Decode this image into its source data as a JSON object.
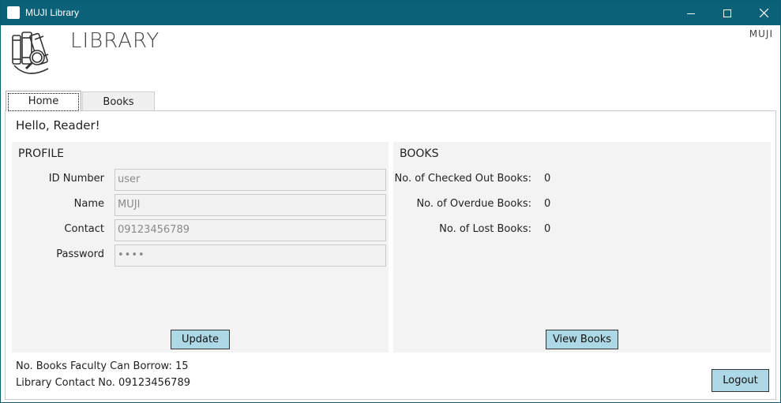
{
  "window": {
    "title": "MUJI Library",
    "controls": {
      "minimize": "minimize-icon",
      "maximize": "maximize-icon",
      "close": "close-icon"
    }
  },
  "header": {
    "brand": "LIBRARY",
    "user_tag": "MUJI",
    "logo_icon": "books-magnifier-icon"
  },
  "tabs": [
    {
      "label": "Home",
      "selected": true
    },
    {
      "label": "Books",
      "selected": false
    }
  ],
  "home": {
    "greeting": "Hello, Reader!",
    "profile": {
      "title": "PROFILE",
      "fields": [
        {
          "label": "ID Number",
          "value": "user"
        },
        {
          "label": "Name",
          "value": "MUJI"
        },
        {
          "label": "Contact",
          "value": "09123456789"
        },
        {
          "label": "Password",
          "value": "••••"
        }
      ],
      "update_label": "Update"
    },
    "books": {
      "title": "BOOKS",
      "stats": [
        {
          "label": "No. of Checked Out Books:",
          "value": "0"
        },
        {
          "label": "No. of Overdue Books:",
          "value": "0"
        },
        {
          "label": "No. of Lost Books:",
          "value": "0"
        }
      ],
      "view_label": "View Books"
    },
    "footer": {
      "faculty_limit": "No. Books Faculty Can Borrow: 15",
      "library_contact": "Library Contact No. 09123456789"
    },
    "logout_label": "Logout"
  },
  "colors": {
    "titlebar": "#0b6178",
    "button": "#add8e6",
    "section_bg": "#f3f3f3"
  }
}
